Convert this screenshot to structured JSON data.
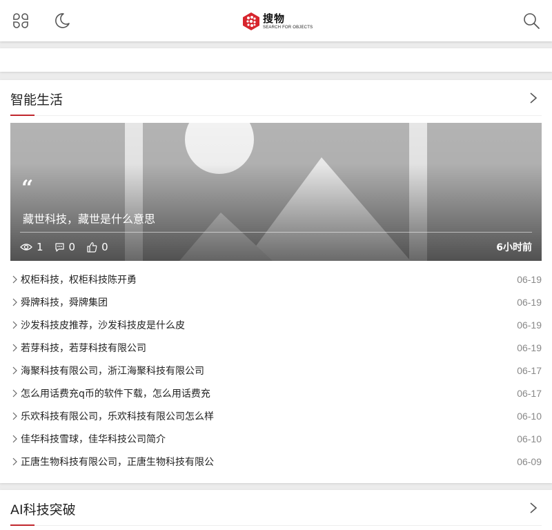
{
  "header": {
    "logo": {
      "name": "搜物",
      "tagline": "SEARCH FOR OBJECTS"
    },
    "icons": {
      "menu": "grid-menu-icon",
      "theme": "moon-icon",
      "search": "search-icon"
    }
  },
  "colors": {
    "accent": "#c0262c",
    "background": "#ececec",
    "card": "#ffffff",
    "date": "#888888"
  },
  "sections": [
    {
      "title": "智能生活",
      "more_icon": "chevron-right-icon",
      "featured": {
        "quote_icon": "quote-icon",
        "title": "藏世科技，藏世是什么意思",
        "views": "1",
        "comments": "0",
        "likes": "0",
        "time": "6小时前"
      },
      "articles": [
        {
          "title": "权柜科技，权柜科技陈开勇",
          "date": "06-19"
        },
        {
          "title": "舜牌科技，舜牌集团",
          "date": "06-19"
        },
        {
          "title": "沙发科技皮推荐，沙发科技皮是什么皮",
          "date": "06-19"
        },
        {
          "title": "若芽科技，若芽科技有限公司",
          "date": "06-19"
        },
        {
          "title": "海聚科技有限公司，浙江海聚科技有限公司",
          "date": "06-17"
        },
        {
          "title": "怎么用话费充q币的软件下载，怎么用话费充",
          "date": "06-17"
        },
        {
          "title": "乐欢科技有限公司，乐欢科技有限公司怎么样",
          "date": "06-10"
        },
        {
          "title": "佳华科技雪球，佳华科技公司简介",
          "date": "06-10"
        },
        {
          "title": "正唐生物科技有限公司，正唐生物科技有限公",
          "date": "06-09"
        }
      ]
    },
    {
      "title": "AI科技突破",
      "more_icon": "chevron-right-icon"
    }
  ]
}
